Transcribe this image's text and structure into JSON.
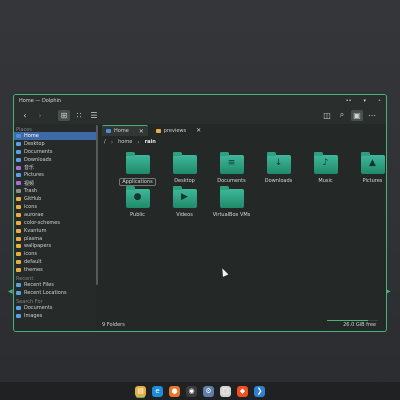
{
  "window": {
    "title": "Home — Dolphin",
    "pin_glyph": "••",
    "minimize_glyph": "▾",
    "close_glyph": "•"
  },
  "toolbar": {
    "back": "‹",
    "forward": "›",
    "view_icons": "⊞",
    "view_compact": "∷",
    "view_details": "☰",
    "split": "◫",
    "search": "⌕",
    "preview": "▣",
    "menu": "⋯"
  },
  "sidebar": {
    "places_title": "Places",
    "places": [
      {
        "label": "Home",
        "icon": "home-icon",
        "color": "#4a8fd8",
        "selected": true
      },
      {
        "label": "Desktop",
        "icon": "desktop-icon"
      },
      {
        "label": "Documents",
        "icon": "documents-icon"
      },
      {
        "label": "Downloads",
        "icon": "downloads-icon"
      },
      {
        "label": "音乐",
        "icon": "music-icon"
      },
      {
        "label": "Pictures",
        "icon": "pictures-icon"
      },
      {
        "label": "视频",
        "icon": "videos-icon"
      },
      {
        "label": "Trash",
        "icon": "trash-icon"
      },
      {
        "label": "GitHub",
        "icon": "folder-icon"
      },
      {
        "label": "icons",
        "icon": "folder-icon"
      },
      {
        "label": "aurorae",
        "icon": "folder-icon"
      },
      {
        "label": "color-schemes",
        "icon": "folder-icon"
      },
      {
        "label": "Kvantum",
        "icon": "folder-icon"
      },
      {
        "label": "plasma",
        "icon": "folder-icon"
      },
      {
        "label": "wallpapers",
        "icon": "folder-icon"
      },
      {
        "label": "icons",
        "icon": "folder-icon"
      },
      {
        "label": "default",
        "icon": "folder-icon"
      },
      {
        "label": "themes",
        "icon": "folder-icon"
      }
    ],
    "recent_title": "Recent",
    "recent": [
      {
        "label": "Recent Files",
        "icon": "recent-files-icon"
      },
      {
        "label": "Recent Locations",
        "icon": "recent-locations-icon"
      }
    ],
    "search_title": "Search For",
    "search": [
      {
        "label": "Documents",
        "icon": "documents-icon"
      },
      {
        "label": "Images",
        "icon": "images-icon"
      }
    ]
  },
  "tabs": [
    {
      "label": "Home",
      "active": true,
      "close": "✕"
    },
    {
      "label": "previews",
      "active": false,
      "close": "✕"
    }
  ],
  "breadcrumb": {
    "root": "/",
    "separator": "›",
    "items": [
      "home",
      "rain"
    ]
  },
  "files": [
    {
      "name": "Applications",
      "glyph": "",
      "selected": true
    },
    {
      "name": "Desktop",
      "glyph": ""
    },
    {
      "name": "Documents",
      "glyph": "≡"
    },
    {
      "name": "Downloads",
      "glyph": "↓"
    },
    {
      "name": "Music",
      "glyph": "♪"
    },
    {
      "name": "Pictures",
      "glyph": "▲"
    },
    {
      "name": "Public",
      "glyph": "●"
    },
    {
      "name": "Videos",
      "glyph": "▶"
    },
    {
      "name": "VirtualBox VMs",
      "glyph": ""
    }
  ],
  "status": {
    "count": "9 Folders",
    "free": "26.0 GiB free",
    "used_fraction": 0.8
  },
  "taskbar": [
    {
      "name": "dolphin",
      "color": "#e3b041",
      "glyph": "▤",
      "active": true
    },
    {
      "name": "edge",
      "color": "#1a8fd8",
      "glyph": "e"
    },
    {
      "name": "firefox",
      "color": "#e8772e",
      "glyph": "●"
    },
    {
      "name": "obs",
      "color": "#3c3c3c",
      "glyph": "◉"
    },
    {
      "name": "settings",
      "color": "#5b7fa8",
      "glyph": "⚙"
    },
    {
      "name": "files",
      "color": "#d4d4d4",
      "glyph": "□"
    },
    {
      "name": "figma",
      "color": "#f24e1e",
      "glyph": "◆"
    },
    {
      "name": "vscode",
      "color": "#2f80d4",
      "glyph": "❯"
    }
  ]
}
